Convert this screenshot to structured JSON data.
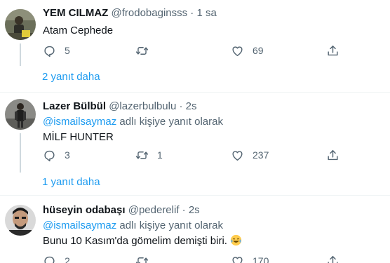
{
  "tweets": [
    {
      "name": "YEM CILMAZ",
      "handle": "@frodobaginsss",
      "dot": "·",
      "time": "1 sa",
      "text": "Atam Cephede",
      "replies": "5",
      "retweets": "",
      "likes": "69",
      "more": "2 yanıt daha"
    },
    {
      "name": "Lazer Bülbül",
      "handle": "@lazerbulbulu",
      "dot": "·",
      "time": "2s",
      "reply_mention": "@ismailsaymaz",
      "reply_suffix": " adlı kişiye yanıt olarak",
      "text": "MİLF HUNTER",
      "replies": "3",
      "retweets": "1",
      "likes": "237",
      "more": "1 yanıt daha"
    },
    {
      "name": "hüseyin odabaşı",
      "handle": "@pederelif",
      "dot": "·",
      "time": "2s",
      "reply_mention": "@ismailsaymaz",
      "reply_suffix": " adlı kişiye yanıt olarak",
      "text": "Bunu 10 Kasım'da gömelim demişti biri.",
      "replies": "2",
      "retweets": "",
      "likes": "170"
    }
  ],
  "icons": {
    "reply": "reply-icon",
    "retweet": "retweet-icon",
    "like": "heart-icon",
    "share": "share-icon",
    "emoji": "laughing-tears-emoji"
  },
  "colors": {
    "accent": "#1d9bf0",
    "text": "#0f1419",
    "muted": "#536471",
    "separator": "#eff3f4"
  }
}
